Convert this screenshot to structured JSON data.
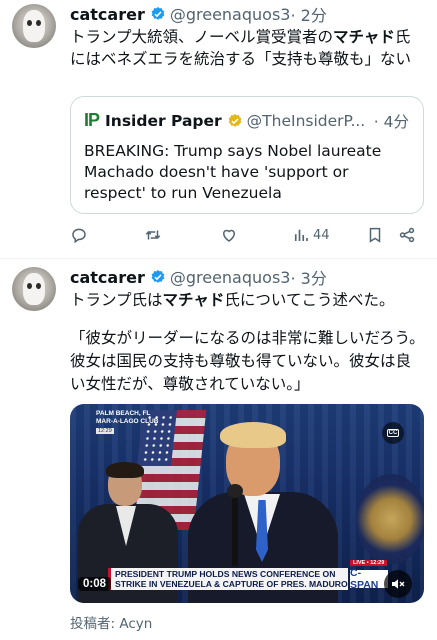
{
  "tweet1": {
    "name": "catcarer",
    "handle": "@greenaquos3",
    "time": "· 2分",
    "text_parts": [
      "トランプ大統領、ノーベル賞受賞者の",
      "マチャド",
      "氏にはベネズエラを統治する「支持も尊敬も」ない"
    ],
    "quote": {
      "logo": "IP",
      "name": "Insider Paper",
      "handle": "@TheInsiderP...",
      "time": "· 4分",
      "text": "BREAKING: Trump says Nobel laureate Machado doesn't have 'support or respect' to run Venezuela"
    },
    "views": "44"
  },
  "tweet2": {
    "name": "catcarer",
    "handle": "@greenaquos3",
    "time": "· 3分",
    "text_line1_parts": [
      "トランプ氏は",
      "マチャド",
      "氏についてこう述べた。"
    ],
    "text_quote": "「彼女がリーダーになるのは非常に難しいだろう。彼女は国民の支持も尊敬も得ていない。彼女は良い女性だが、尊敬されていない。」",
    "video": {
      "location": "PALM BEACH, FL\nMAR-A-LAGO CLUB",
      "clock": "12:29",
      "ticker_line1": "PRESIDENT TRUMP HOLDS NEWS CONFERENCE ON",
      "ticker_line2": "STRIKE IN VENEZUELA & CAPTURE OF PRES. MADURO",
      "live": "LIVE • 12:29",
      "network": "C-SPAN",
      "duration": "0:08",
      "cc": "CC"
    },
    "poster": "投稿者: Acyn"
  },
  "colors": {
    "text": "#0f1419",
    "secondary": "#536471",
    "verified_blue": "#1d9bf0",
    "verified_gold": "#e2b719",
    "border": "#cfd9de"
  },
  "icons": [
    "verified-badge-icon",
    "gold-verified-badge-icon",
    "reply-icon",
    "retweet-icon",
    "like-icon",
    "views-icon",
    "bookmark-icon",
    "share-icon",
    "cc-icon",
    "mute-icon"
  ]
}
